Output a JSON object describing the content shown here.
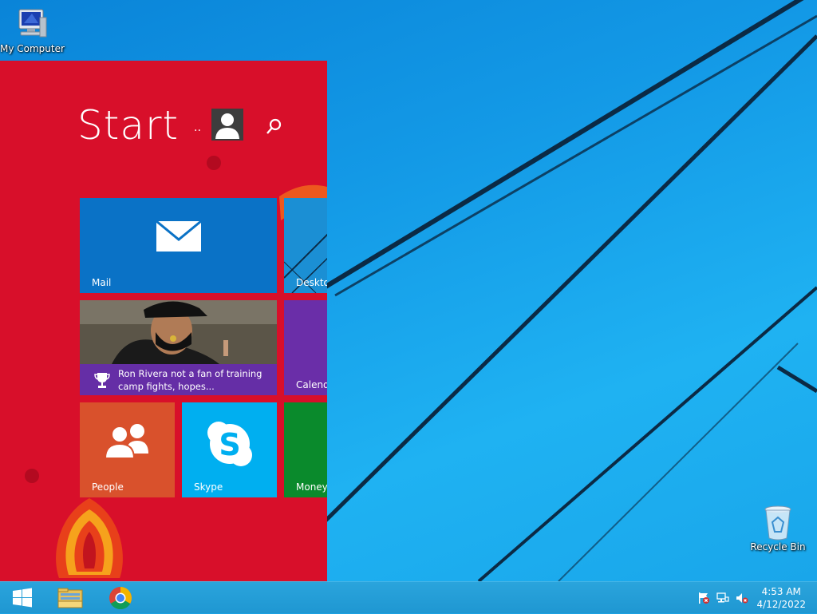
{
  "desktop": {
    "icons": [
      {
        "label": "My Computer",
        "icon": "computer-icon"
      },
      {
        "label": "Recycle Bin",
        "icon": "recycle-bin-icon"
      }
    ],
    "background_color": "#1ba1e2"
  },
  "start": {
    "title": "Start",
    "user_dots": "..",
    "background_color": "#d80f2a",
    "tiles": {
      "mail": {
        "label": "Mail",
        "icon": "envelope-icon",
        "color": "#0a72c6"
      },
      "desktop": {
        "label": "Desktop",
        "color": "#1b8fd4"
      },
      "news": {
        "caption": "Ron Rivera not a fan of training camp fights, hopes...",
        "icon": "trophy-icon",
        "color": "#682daf"
      },
      "calendar": {
        "label": "Calendar",
        "color": "#6a2ea8"
      },
      "people": {
        "label": "People",
        "icon": "people-icon",
        "color": "#d9512c"
      },
      "skype": {
        "label": "Skype",
        "icon": "skype-icon",
        "color": "#00aff0"
      },
      "money": {
        "label": "Money",
        "color": "#0a8a2c"
      }
    }
  },
  "taskbar": {
    "pinned": [
      "windows-start-icon",
      "file-explorer-icon",
      "chrome-icon"
    ],
    "tray": [
      "action-center-flag-icon",
      "network-icon",
      "volume-muted-icon"
    ],
    "clock": {
      "time": "4:53 AM",
      "date": "4/12/2022"
    }
  }
}
